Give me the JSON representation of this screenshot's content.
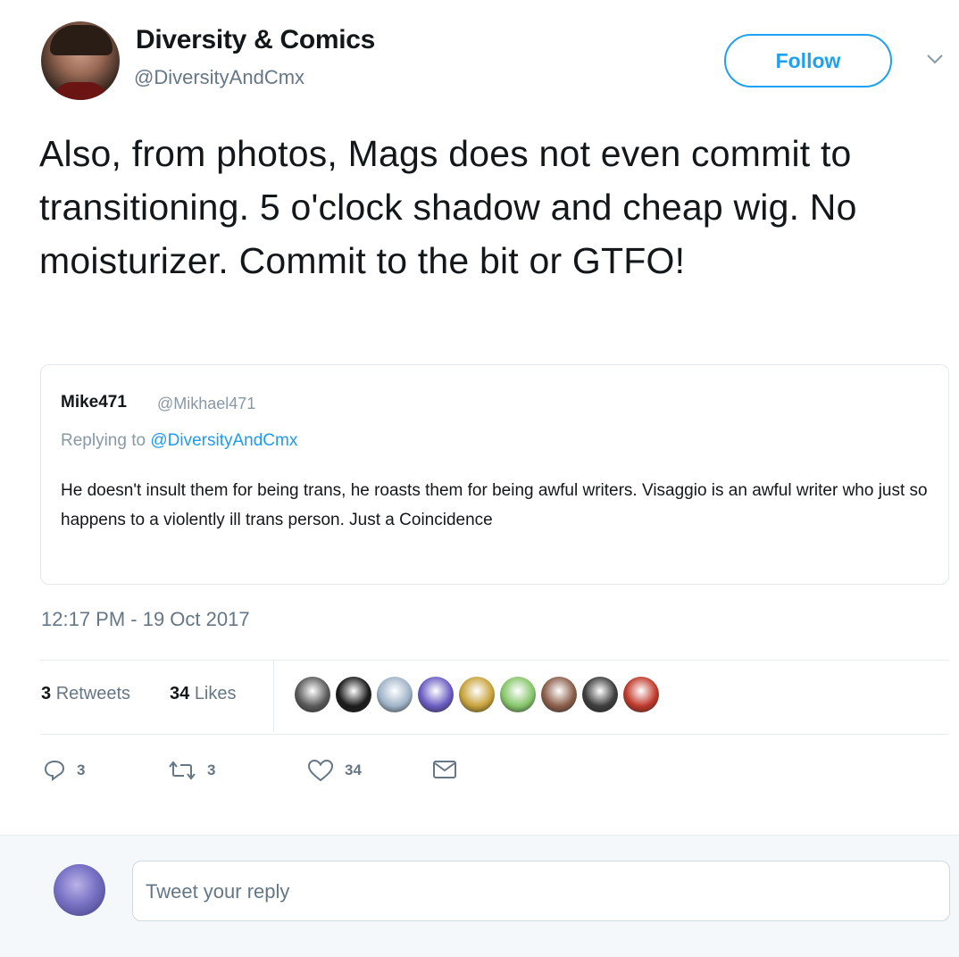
{
  "author": {
    "name": "Diversity & Comics",
    "handle": "@DiversityAndCmx"
  },
  "follow_label": "Follow",
  "tweet_text": "Also, from photos, Mags does not even commit to transitioning. 5 o'clock shadow and cheap wig. No moisturizer. Commit to the bit or GTFO!",
  "quoted": {
    "name": "Mike471",
    "handle": "@Mikhael471",
    "replying_prefix": "Replying to",
    "replying_to": "@DiversityAndCmx",
    "text": "He doesn't insult them for being trans, he roasts them for being awful writers. Visaggio is an awful writer who just so happens to a violently ill trans person. Just a Coincidence"
  },
  "timestamp": "12:17 PM - 19 Oct 2017",
  "stats": {
    "retweets_count": "3",
    "retweets_label": "Retweets",
    "likes_count": "34",
    "likes_label": "Likes"
  },
  "likers": [
    {
      "name": "liker-avatar",
      "color": "#5a5a5a"
    },
    {
      "name": "liker-avatar",
      "color": "#1b1b1b"
    },
    {
      "name": "liker-avatar",
      "color": "#9fb3c8"
    },
    {
      "name": "liker-avatar",
      "color": "#6a5cc2"
    },
    {
      "name": "liker-avatar",
      "color": "#c8a23a"
    },
    {
      "name": "liker-avatar",
      "color": "#86c56a"
    },
    {
      "name": "liker-avatar",
      "color": "#8b5e4a"
    },
    {
      "name": "liker-avatar",
      "color": "#3d3d3d"
    },
    {
      "name": "liker-avatar",
      "color": "#c0392b"
    }
  ],
  "actions": {
    "reply_count": "3",
    "retweet_count": "3",
    "like_count": "34"
  },
  "reply_placeholder": "Tweet your reply",
  "colors": {
    "accent": "#1da1f2",
    "secondary_text": "#657786",
    "reply_bar_bg": "#f5f8fa"
  }
}
